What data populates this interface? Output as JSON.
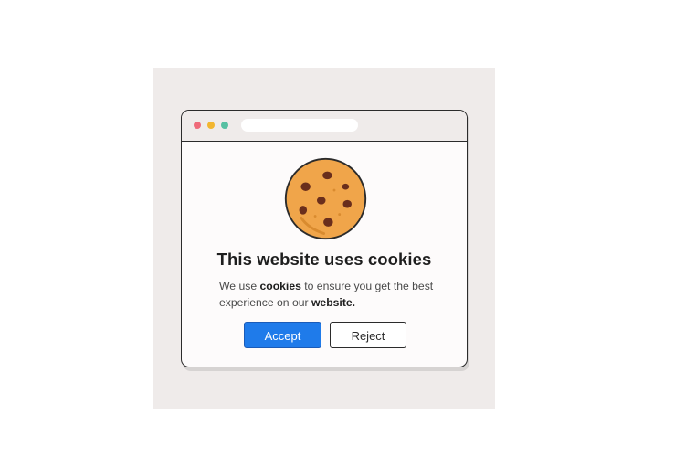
{
  "dialog": {
    "title": "This website uses cookies",
    "message": {
      "part1": "We use ",
      "bold1": "cookies",
      "part2": " to ensure you get the best experience on our ",
      "bold2": "website",
      "part3": "."
    },
    "accept_label": "Accept",
    "reject_label": "Reject"
  },
  "icons": {
    "window_controls": [
      "close-dot-icon",
      "minimize-dot-icon",
      "maximize-dot-icon"
    ],
    "illustration": "cookie-icon"
  },
  "colors": {
    "backdrop": "#efebea",
    "accept_button": "#1f7bea",
    "cookie": "#f0a54a",
    "chips": "#6a2e1c",
    "dot_red": "#ef6b7a",
    "dot_yellow": "#f2b630",
    "dot_green": "#56c0a2"
  }
}
